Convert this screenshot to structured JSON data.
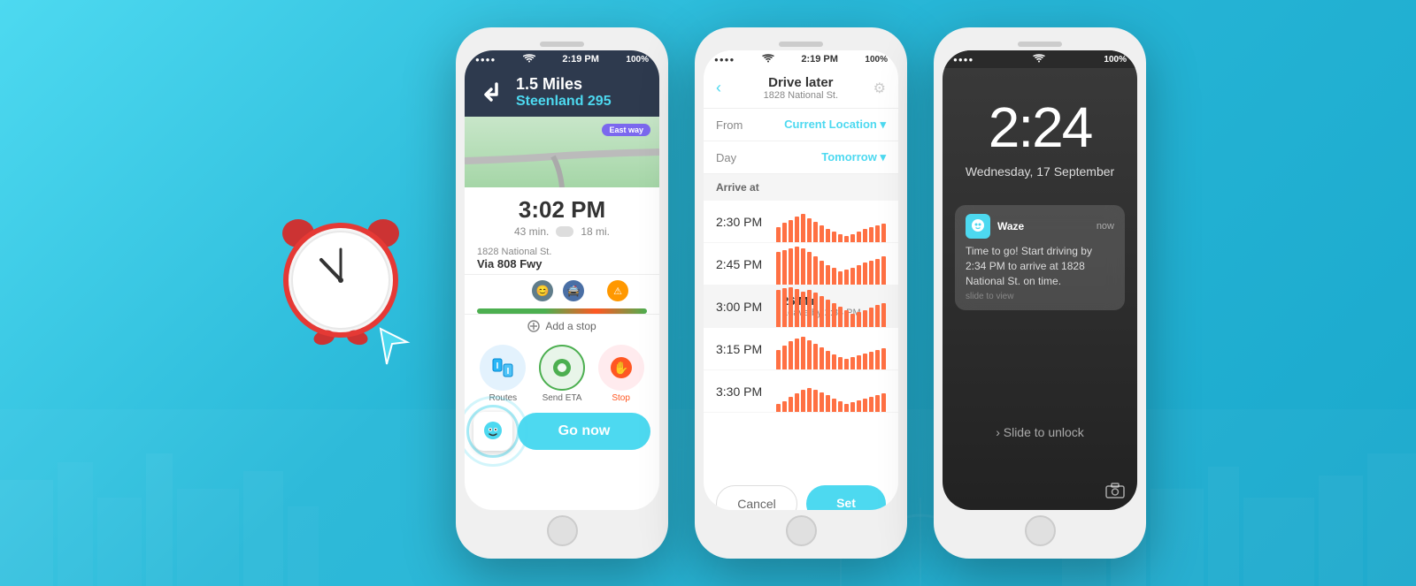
{
  "background": {
    "color_start": "#4dd9f0",
    "color_end": "#1aa8cc"
  },
  "mascot": {
    "alt": "Alarm clock mascot with cursor arrow"
  },
  "phone1": {
    "status_bar": {
      "signal": "●●●●",
      "wifi": "WiFi",
      "time": "2:19 PM",
      "battery": "100%"
    },
    "nav_header": {
      "distance": "1.5 Miles",
      "street": "Steenland 295",
      "direction": "↰"
    },
    "map": {
      "badge": "East way"
    },
    "eta": {
      "time": "3:02 PM",
      "minutes": "43 min.",
      "miles": "18 mi."
    },
    "route": {
      "destination": "1828 National St.",
      "via": "Via 808 Fwy"
    },
    "add_stop_label": "Add a stop",
    "actions": {
      "routes_label": "Routes",
      "send_eta_label": "Send ETA",
      "stop_label": "Stop"
    },
    "go_now_label": "Go now"
  },
  "phone2": {
    "status_bar": {
      "signal": "●●●●",
      "wifi": "WiFi",
      "time": "2:19 PM",
      "battery": "100%"
    },
    "header": {
      "title": "Drive later",
      "subtitle": "1828 National St.",
      "back": "‹",
      "settings": "⚙"
    },
    "from_row": {
      "label": "From",
      "value": "Current Location ▾"
    },
    "day_row": {
      "label": "Day",
      "value": "Tomorrow ▾"
    },
    "arrive_at_header": "Arrive at",
    "time_slots": [
      {
        "time": "2:30 PM",
        "highlighted": false,
        "info_title": "",
        "info_sub": ""
      },
      {
        "time": "2:45 PM",
        "highlighted": false,
        "info_title": "",
        "info_sub": ""
      },
      {
        "time": "3:00 PM",
        "highlighted": true,
        "info_title": "26 Min",
        "info_sub": "Leave by 2:34 PM"
      },
      {
        "time": "3:15 PM",
        "highlighted": false,
        "info_title": "",
        "info_sub": ""
      },
      {
        "time": "3:30 PM",
        "highlighted": false,
        "info_title": "",
        "info_sub": ""
      }
    ],
    "cancel_label": "Cancel",
    "set_label": "Set"
  },
  "phone3": {
    "status_bar": {
      "signal": "●●●●",
      "wifi": "WiFi",
      "time": "",
      "battery": "100%"
    },
    "lock_time": "2:24",
    "lock_date": "Wednesday, 17 September",
    "notification": {
      "app_name": "Waze",
      "time": "now",
      "message": "Time to go! Start driving by 2:34 PM to arrive at 1828 National St. on time.",
      "slide_hint": "slide to view"
    },
    "slide_to_unlock": "› Slide to unlock",
    "camera_icon": "📷"
  }
}
